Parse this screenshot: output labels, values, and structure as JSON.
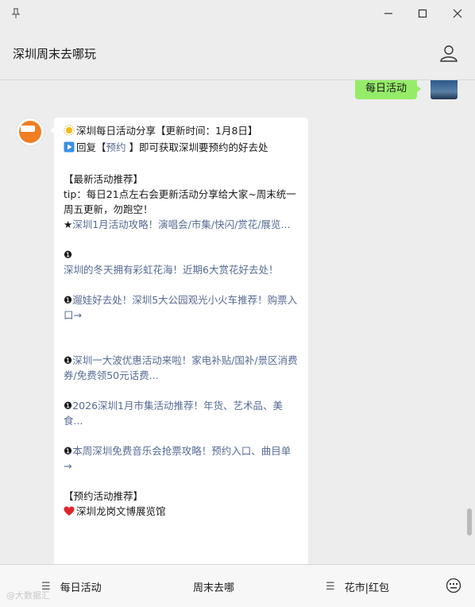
{
  "window": {
    "controls": [
      "pin-icon",
      "minimize-icon",
      "maximize-icon",
      "close-icon"
    ]
  },
  "header": {
    "title": "深圳周末去哪玩"
  },
  "sent": {
    "text": "每日活动"
  },
  "message": {
    "l1": "深圳每日活动分享【更新时间：1月8日】",
    "l2_pre": "回复【",
    "l2_link": "预约",
    "l2_post": " 】即可获取深圳要预约的好去处",
    "latest_header": "【最新活动推荐】",
    "tip": "tip：每日21点左右会更新活动分享给大家~周末统一周五更新，勿跑空！",
    "star_pre": "★",
    "star_link": "深圳1月活动攻略！演唱会/市集/快闪/赏花/展览...",
    "b1": "❶",
    "b1_link": "深圳的冬天拥有彩虹花海！近期6大赏花好去处！",
    "b2_link": "遛娃好去处！深圳5大公园观光小火车推荐！购票入口→",
    "b3_link": "深圳一大波优惠活动来啦！家电补贴/国补/景区消费券/免费领50元话费...",
    "b4_link": "2026深圳1月市集活动推荐！年货、艺术品、美食...",
    "b5_link": "本周深圳免费音乐会抢票攻略！预约入口、曲目单→",
    "booking_header": "【预约活动推荐】",
    "booking_item": "深圳龙岗文博展览馆"
  },
  "bottom_menu": [
    {
      "label": "每日活动"
    },
    {
      "label": "周末去哪"
    },
    {
      "label": "花市|红包"
    }
  ],
  "watermark": "@大数据汇",
  "colors": {
    "bubble_green": "#95ec69",
    "link": "#576b95",
    "background": "#ededed"
  }
}
